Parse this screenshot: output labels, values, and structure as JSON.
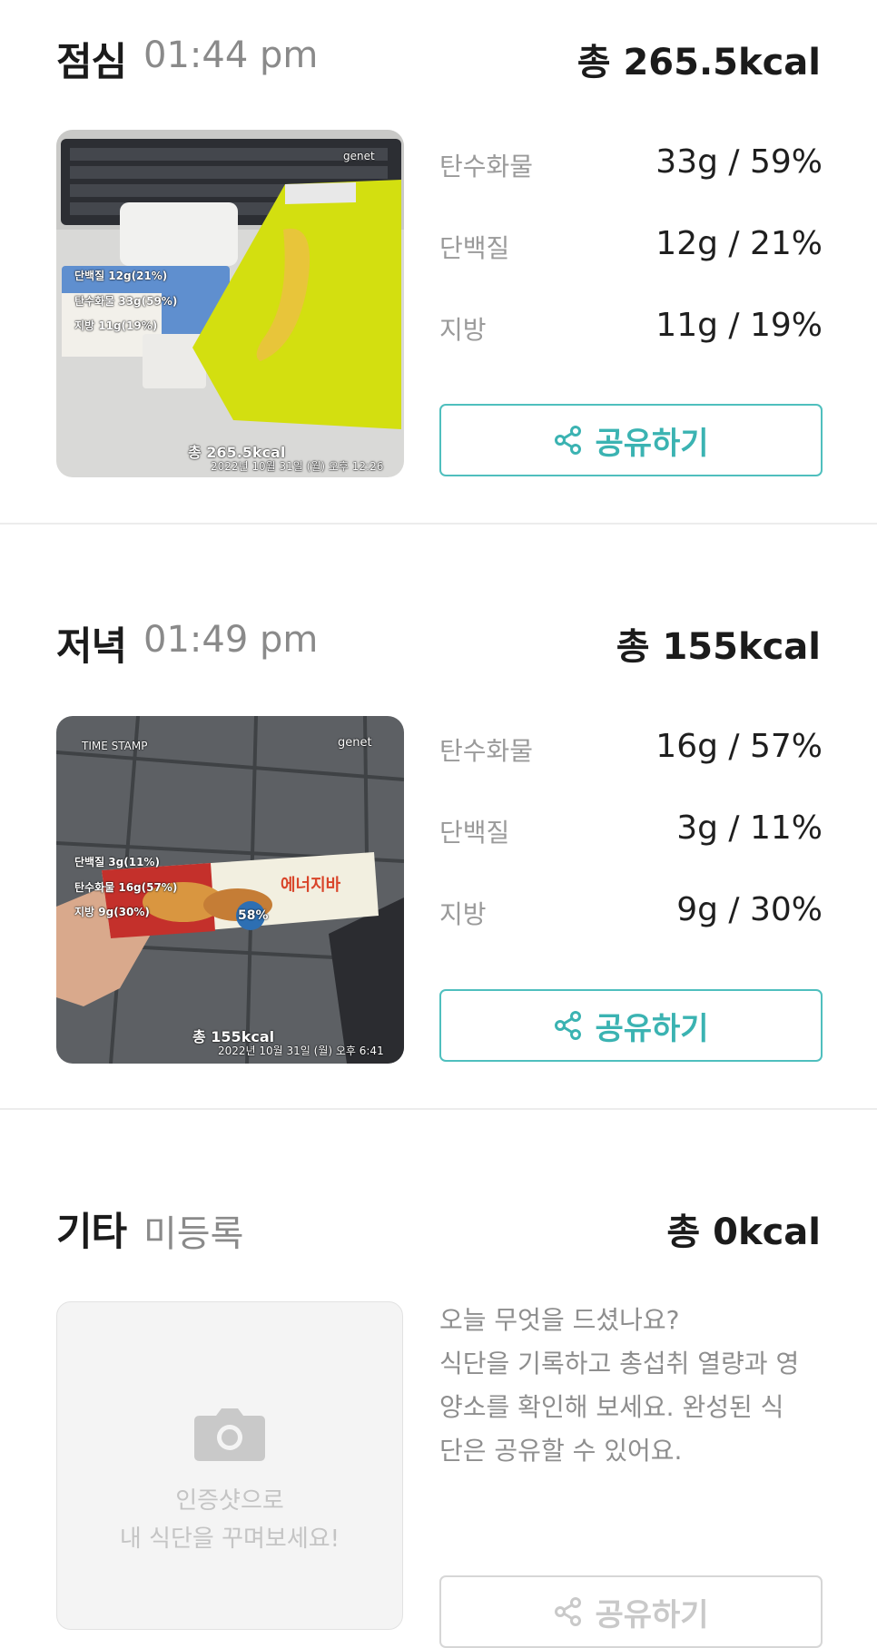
{
  "meals": [
    {
      "title": "점심",
      "time": "01:44 pm",
      "total": "총 265.5kcal",
      "photo": {
        "label_protein": "단백질 12g(21%)",
        "label_carbs": "탄수화물 33g(59%)",
        "label_fat": "지방 11g(19%)",
        "total": "총 265.5kcal",
        "datetime": "2022년 10월 31일 (월) 오후 12:26",
        "brand": "genet"
      },
      "nutrients": [
        {
          "name": "탄수화물",
          "value": "33g / 59%"
        },
        {
          "name": "단백질",
          "value": "12g / 21%"
        },
        {
          "name": "지방",
          "value": "11g / 19%"
        }
      ],
      "share_label": "공유하기"
    },
    {
      "title": "저녁",
      "time": "01:49 pm",
      "total": "총 155kcal",
      "photo": {
        "stamp": "TIME STAMP",
        "brand": "genet",
        "label_protein": "단백질 3g(11%)",
        "label_carbs": "탄수화물 16g(57%)",
        "label_fat": "지방 9g(30%)",
        "total": "총 155kcal",
        "datetime": "2022년 10월 31일 (월) 오후 6:41",
        "product": "에너지바",
        "percent": "58%"
      },
      "nutrients": [
        {
          "name": "탄수화물",
          "value": "16g / 57%"
        },
        {
          "name": "단백질",
          "value": "3g / 11%"
        },
        {
          "name": "지방",
          "value": "9g / 30%"
        }
      ],
      "share_label": "공유하기"
    }
  ],
  "other": {
    "title": "기타",
    "status": "미등록",
    "total": "총 0kcal",
    "placeholder_line1": "인증샷으로",
    "placeholder_line2": "내 식단을 꾸며보세요!",
    "desc_line1": "오늘 무엇을 드셨나요?",
    "desc_line2": "식단을 기록하고 총섭취 열량과 영",
    "desc_line3": "양소를 확인해 보세요. 완성된 식",
    "desc_line4": "단은 공유할 수 있어요.",
    "share_label": "공유하기"
  },
  "colors": {
    "accent": "#4fbfbe",
    "muted": "#8a8a8a",
    "divider": "#ececec"
  }
}
